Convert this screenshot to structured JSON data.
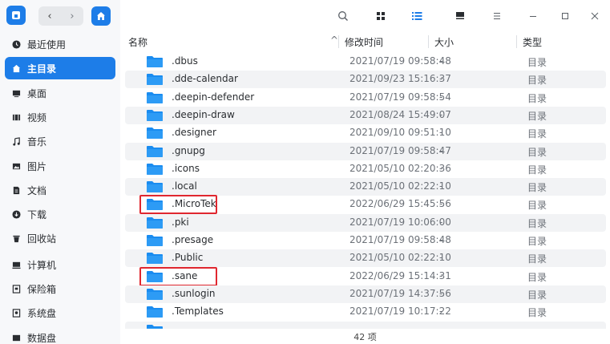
{
  "sidebar": {
    "items": [
      {
        "label": "最近使用",
        "icon": "clock-icon"
      },
      {
        "label": "主目录",
        "icon": "home-icon",
        "active": true
      },
      {
        "label": "桌面",
        "icon": "desktop-icon"
      },
      {
        "label": "视频",
        "icon": "video-icon"
      },
      {
        "label": "音乐",
        "icon": "music-icon"
      },
      {
        "label": "图片",
        "icon": "picture-icon"
      },
      {
        "label": "文档",
        "icon": "document-icon"
      },
      {
        "label": "下载",
        "icon": "download-icon"
      },
      {
        "label": "回收站",
        "icon": "trash-icon"
      },
      {
        "label": "计算机",
        "icon": "computer-icon"
      },
      {
        "label": "保险箱",
        "icon": "safe-icon"
      },
      {
        "label": "系统盘",
        "icon": "system-disk-icon"
      },
      {
        "label": "数据盘",
        "icon": "data-disk-icon"
      }
    ]
  },
  "toolbar": {
    "back": "‹",
    "forward": "›"
  },
  "columns": {
    "name": "名称",
    "sort_indicator": "^",
    "modified": "修改时间",
    "size": "大小",
    "type": "类型"
  },
  "files": [
    {
      "name": ".dbus",
      "time": "2021/07/19 09:58:48",
      "size": "-",
      "type": "目录"
    },
    {
      "name": ".dde-calendar",
      "time": "2021/09/23 15:16:37",
      "size": "-",
      "type": "目录"
    },
    {
      "name": ".deepin-defender",
      "time": "2021/07/19 09:58:54",
      "size": "-",
      "type": "目录"
    },
    {
      "name": ".deepin-draw",
      "time": "2021/08/24 15:49:07",
      "size": "-",
      "type": "目录"
    },
    {
      "name": ".designer",
      "time": "2021/09/10 09:51:10",
      "size": "-",
      "type": "目录"
    },
    {
      "name": ".gnupg",
      "time": "2021/07/19 09:58:47",
      "size": "-",
      "type": "目录"
    },
    {
      "name": ".icons",
      "time": "2021/05/10 02:20:36",
      "size": "-",
      "type": "目录"
    },
    {
      "name": ".local",
      "time": "2021/05/10 02:22:10",
      "size": "-",
      "type": "目录"
    },
    {
      "name": ".MicroTek",
      "time": "2022/06/29 15:45:56",
      "size": "-",
      "type": "目录",
      "highlight": true
    },
    {
      "name": ".pki",
      "time": "2021/07/19 10:06:00",
      "size": "-",
      "type": "目录"
    },
    {
      "name": ".presage",
      "time": "2021/07/19 09:58:48",
      "size": "-",
      "type": "目录"
    },
    {
      "name": ".Public",
      "time": "2021/05/10 02:22:10",
      "size": "-",
      "type": "目录"
    },
    {
      "name": ".sane",
      "time": "2022/06/29 15:14:31",
      "size": "-",
      "type": "目录",
      "highlight": true
    },
    {
      "name": ".sunlogin",
      "time": "2021/07/19 14:37:56",
      "size": "-",
      "type": "目录"
    },
    {
      "name": ".Templates",
      "time": "2021/07/19 10:17:22",
      "size": "-",
      "type": "目录"
    }
  ],
  "status": {
    "count": "42 项"
  },
  "colors": {
    "accent": "#1d7de8",
    "highlight_box": "#e0272f"
  }
}
